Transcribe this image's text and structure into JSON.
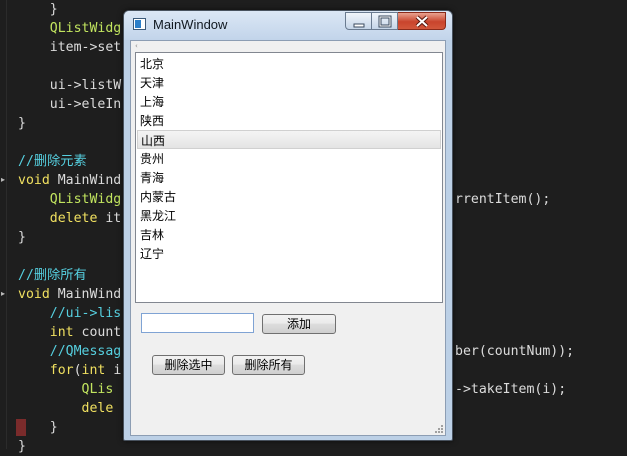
{
  "window": {
    "title": "MainWindow",
    "toolbar_handle": "‹"
  },
  "list": {
    "items": [
      "北京",
      "天津",
      "上海",
      "陕西",
      "山西",
      "贵州",
      "青海",
      "内蒙古",
      "黑龙江",
      "吉林",
      "辽宁"
    ],
    "hovered_index": 4
  },
  "form": {
    "input_value": "",
    "add_label": "添加",
    "delete_selected_label": "删除选中",
    "delete_all_label": "删除所有"
  },
  "editor": {
    "lines": [
      "    }",
      "    QListWidg",
      "    item->set",
      "",
      "    ui->listW",
      "    ui->eleIn",
      "}",
      "",
      "//删除元素",
      "void MainWind",
      "    QListWidg",
      "    delete it",
      "}",
      "",
      "//删除所有",
      "void MainWind",
      "    //ui->lis",
      "    int count",
      "    //QMessag",
      "    for(int i",
      "        QLis",
      "        dele",
      "    }",
      "}"
    ],
    "right_fragments": [
      {
        "line": 10,
        "text": "rrentItem();"
      },
      {
        "line": 18,
        "text": "ber(countNum));"
      },
      {
        "line": 20,
        "text": "->takeItem(i);"
      }
    ]
  },
  "colors": {
    "editor_bg": "#1e1e1e",
    "keyword": "#f0e060",
    "type": "#c2e55f",
    "comment": "#56d0e0",
    "plain": "#dcdcdc"
  }
}
